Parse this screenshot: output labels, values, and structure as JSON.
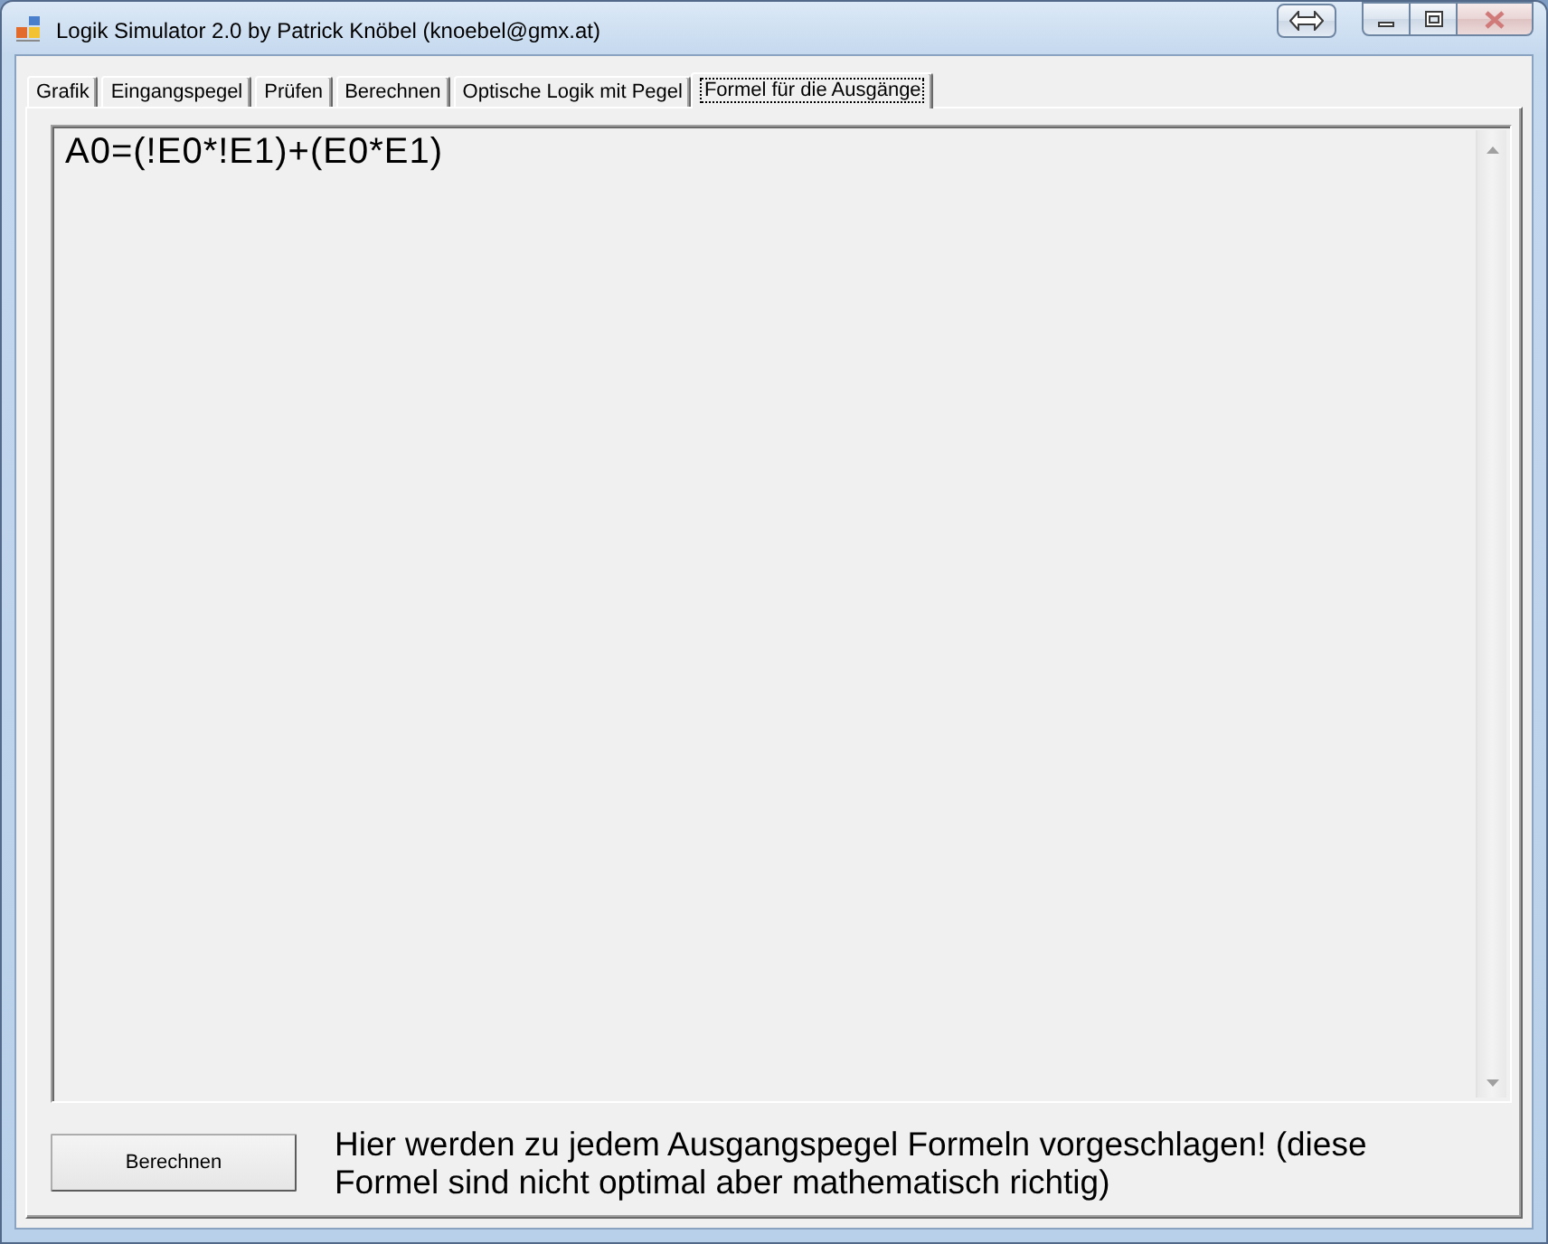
{
  "window": {
    "title": "Logik Simulator 2.0 by Patrick Knöbel (knoebel@gmx.at)"
  },
  "tabs": [
    {
      "label": "Grafik",
      "selected": false
    },
    {
      "label": "Eingangspegel",
      "selected": false
    },
    {
      "label": "Prüfen",
      "selected": false
    },
    {
      "label": "Berechnen",
      "selected": false
    },
    {
      "label": "Optische Logik mit Pegel",
      "selected": false
    },
    {
      "label": "Formel für die Ausgänge",
      "selected": true
    }
  ],
  "output": {
    "lines": [
      "A0=(!E0*!E1)+(E0*E1)"
    ]
  },
  "button": {
    "label": "Berechnen"
  },
  "hint": "Hier werden zu jedem Ausgangspegel Formeln vorgeschlagen! (diese Formel sind nicht optimal aber mathematisch richtig)"
}
